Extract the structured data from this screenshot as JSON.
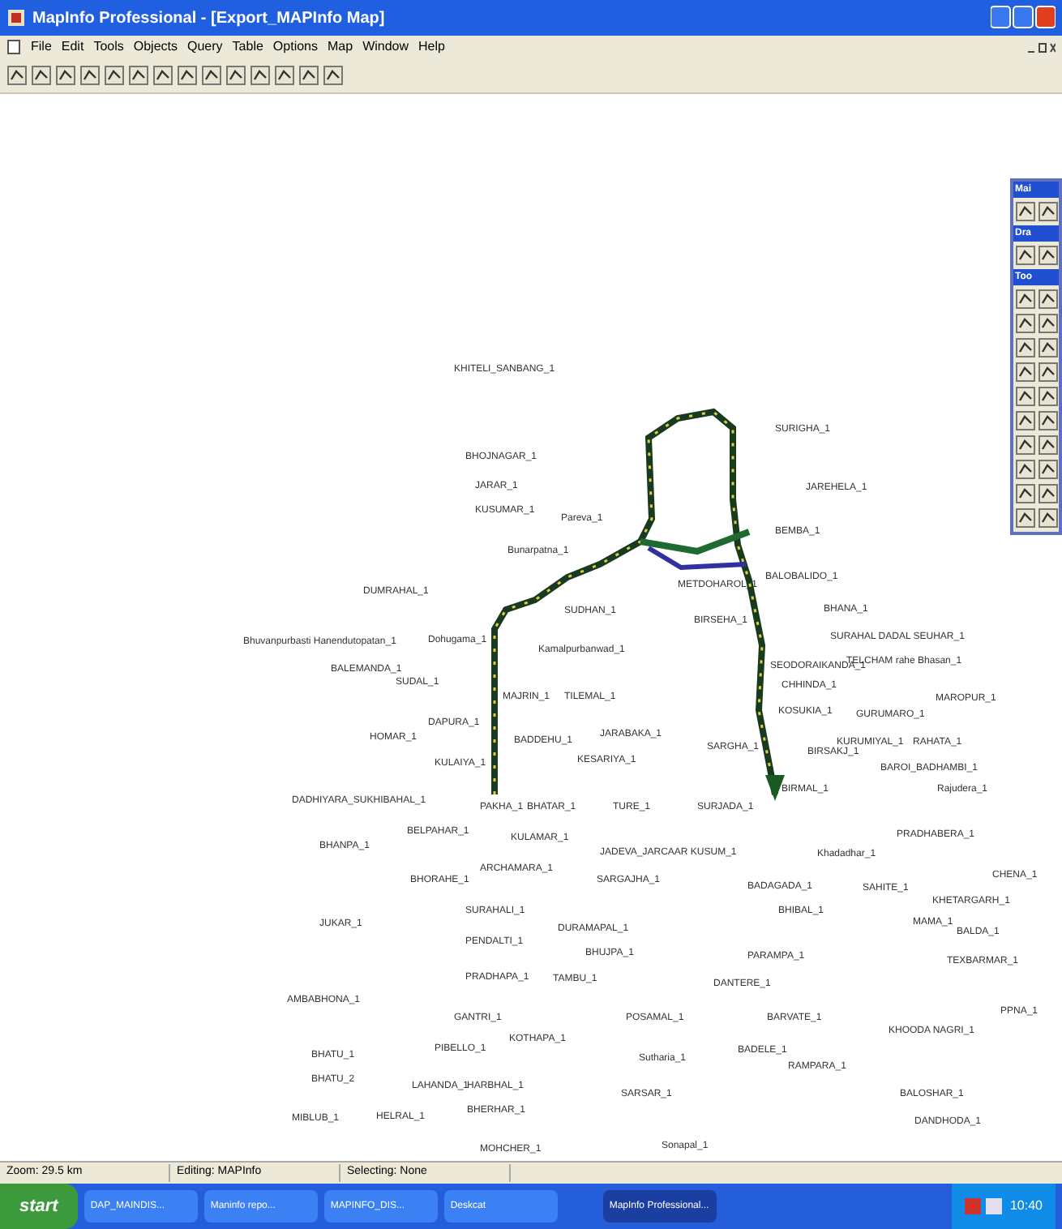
{
  "window": {
    "title": "MapInfo Professional - [Export_MAPInfo Map]"
  },
  "menu": [
    "File",
    "Edit",
    "Tools",
    "Objects",
    "Query",
    "Table",
    "Options",
    "Map",
    "Window",
    "Help"
  ],
  "map_labels": [
    "KHITELI_SANBANG_1",
    "BHOJNAGAR_1",
    "JARAR_1",
    "KUSUMAR_1",
    "Pareva_1",
    "Bunarpatna_1",
    "DUMRAHAL_1",
    "SUDHAN_1",
    "Bhuvanpurbasti Hanendutopatan_1",
    "BALEMANDA_1",
    "SUDAL_1",
    "Dohugama_1",
    "Kamalpurbanwad_1",
    "MAJRIN_1",
    "TILEMAL_1",
    "DAPURA_1",
    "HOMAR_1",
    "BADDEHU_1",
    "JARABAKA_1",
    "KULAIYA_1",
    "KESARIYA_1",
    "DADHIYARA_SUKHIBAHAL_1",
    "PAKHA_1",
    "BHATAR_1",
    "TURE_1",
    "SURJADA_1",
    "BELPAHAR_1",
    "KULAMAR_1",
    "BHANPA_1",
    "JADEVA_JARCAAR KUSUM_1",
    "BHORAHE_1",
    "ARCHAMARA_1",
    "SARGAJHA_1",
    "JUKAR_1",
    "SURAHALI_1",
    "DURAMAPAL_1",
    "PENDALTI_1",
    "BHUJPA_1",
    "PRADHAPA_1",
    "TAMBU_1",
    "AMBABHONA_1",
    "GANTRI_1",
    "POSAMAL_1",
    "KOTHAPA_1",
    "PIBELLO_1",
    "BHATU_1",
    "BHATU_2",
    "LAHANDA_1",
    "HARBHAL_1",
    "Sutharia_1",
    "SARSAR_1",
    "MIBLUB_1",
    "HELRAL_1",
    "BHERHAR_1",
    "MOHCHER_1",
    "Sonapal_1",
    "SURIGHA_1",
    "JAREHELA_1",
    "BEMBA_1",
    "METDOHAROL_1",
    "BALOBALIDO_1",
    "BHANA_1",
    "BIRSEHA_1",
    "SURAHAL DADAL SEUHAR_1",
    "TELCHAM rahe Bhasan_1",
    "SEODORAIKANDA_1",
    "CHHINDA_1",
    "MAROPUR_1",
    "KOSUKIA_1",
    "GURUMARO_1",
    "KURUMIYAL_1",
    "RAHATA_1",
    "SARGHA_1",
    "BIRSAKJ_1",
    "BAROI_BADHAMBI_1",
    "BIRMAL_1",
    "Rajudera_1",
    "PRADHABERA_1",
    "Khadadhar_1",
    "CHENA_1",
    "BADAGADA_1",
    "SAHITE_1",
    "KHETARGARH_1",
    "BHIBAL_1",
    "MAMA_1",
    "BALDA_1",
    "PARAMPA_1",
    "TEXBARMAR_1",
    "DANTERE_1",
    "PPNA_1",
    "BARVATE_1",
    "KHOODA NAGRI_1",
    "BADELE_1",
    "RAMPARA_1",
    "BALOSHAR_1",
    "DANDHODA_1"
  ],
  "palettes": [
    {
      "title": "Mai",
      "kind": "main"
    },
    {
      "title": "Dra",
      "kind": "drawing"
    },
    {
      "title": "Too",
      "kind": "tools"
    }
  ],
  "status_bar": [
    "Zoom: 29.5 km",
    "Editing: MAPInfo",
    "Selecting: None"
  ],
  "taskbar": {
    "start": "start",
    "clock": "10:40",
    "tasks": [
      {
        "label": "DAP_MAINDIS...",
        "selected": false
      },
      {
        "label": "Maninfo repo...",
        "selected": false
      },
      {
        "label": "MAPINFO_DIS...",
        "selected": false
      },
      {
        "label": "Deskcat",
        "selected": false
      },
      {
        "label": "MapInfo Professional...",
        "selected": true
      }
    ]
  }
}
